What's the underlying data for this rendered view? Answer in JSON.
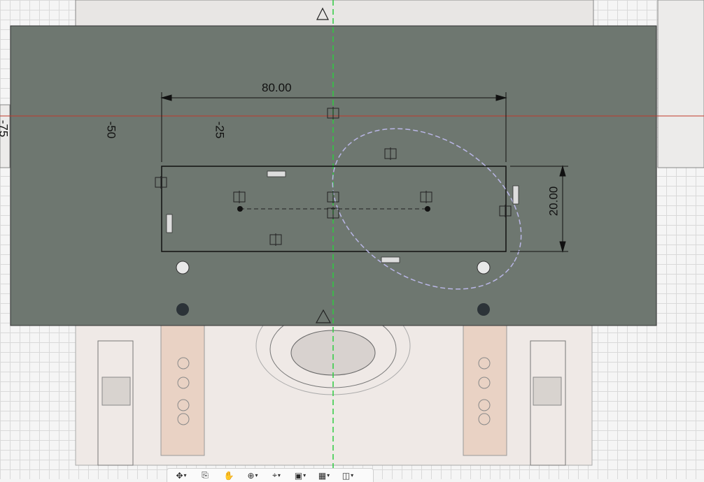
{
  "dimensions": {
    "width_label": "80.00",
    "height_label": "20.00",
    "offset_50": "-50",
    "offset_25": "-25",
    "offset_75": "-75"
  },
  "navbar": {
    "tools": [
      {
        "name": "orbit-tool",
        "icon": "orbit-icon",
        "glyph": "✥",
        "has_menu": true
      },
      {
        "name": "look-at-tool",
        "icon": "look-at-icon",
        "glyph": "⎘",
        "has_menu": false
      },
      {
        "name": "pan-tool",
        "icon": "pan-hand-icon",
        "glyph": "✋",
        "has_menu": false
      },
      {
        "name": "zoom-tool",
        "icon": "zoom-icon",
        "glyph": "⊕",
        "has_menu": true
      },
      {
        "name": "fit-tool",
        "icon": "fit-icon",
        "glyph": "⌖",
        "has_menu": true
      },
      {
        "name": "display-settings",
        "icon": "display-settings-icon",
        "glyph": "▣",
        "has_menu": true
      },
      {
        "name": "grid-settings",
        "icon": "grid-icon",
        "glyph": "▦",
        "has_menu": true
      },
      {
        "name": "viewports",
        "icon": "viewports-icon",
        "glyph": "◫",
        "has_menu": true
      }
    ]
  },
  "colors": {
    "plate": "#6e7770",
    "sketch_line": "#111111",
    "construction_ellipse": "#b9b6e6",
    "x_axis": "#c0392b",
    "y_axis": "#2ecc40"
  }
}
